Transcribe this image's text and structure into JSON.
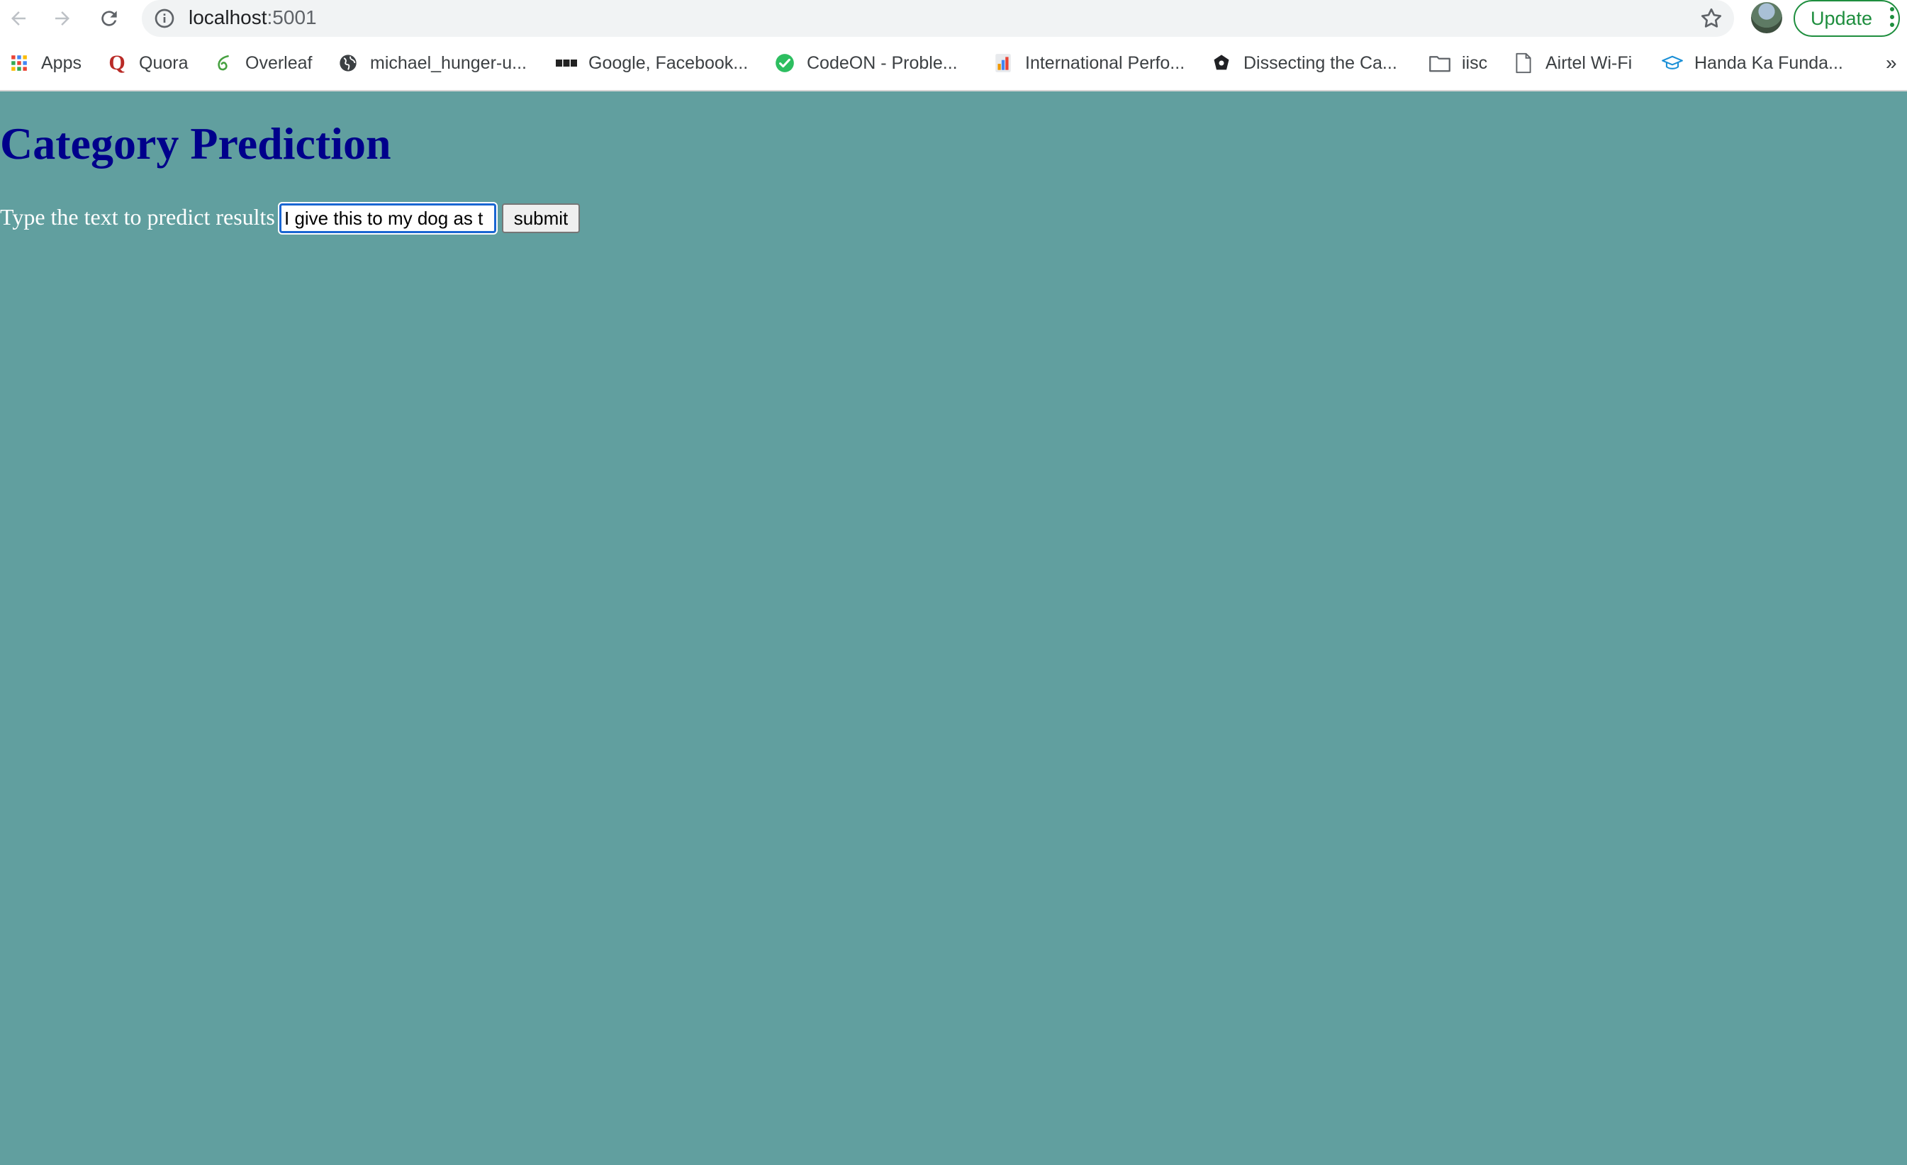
{
  "browser": {
    "url_host": "localhost",
    "url_port": ":5001",
    "update_label": "Update",
    "accent_color": "#1e8e3e"
  },
  "bookmarks": [
    {
      "label": "Apps",
      "icon": "apps-grid-icon"
    },
    {
      "label": "Quora",
      "icon": "quora-icon"
    },
    {
      "label": "Overleaf",
      "icon": "overleaf-icon"
    },
    {
      "label": "michael_hunger-u...",
      "icon": "globe-icon"
    },
    {
      "label": "Google, Facebook...",
      "icon": "bbc-icon"
    },
    {
      "label": "CodeON - Proble...",
      "icon": "check-circle-icon"
    },
    {
      "label": "International Perfo...",
      "icon": "document-chart-icon"
    },
    {
      "label": "Dissecting the Ca...",
      "icon": "dark-logo-icon"
    },
    {
      "label": "iisc",
      "icon": "folder-icon"
    },
    {
      "label": "Airtel Wi-Fi",
      "icon": "page-icon"
    },
    {
      "label": "Handa Ka Funda...",
      "icon": "graduation-cap-icon"
    }
  ],
  "bookmarks_overflow": "»",
  "page": {
    "title": "Category Prediction",
    "prompt": "Type the text to predict results",
    "input_value": "I give this to my dog as t",
    "submit_label": "submit",
    "background_color": "#619f9f",
    "title_color": "#00008b"
  }
}
